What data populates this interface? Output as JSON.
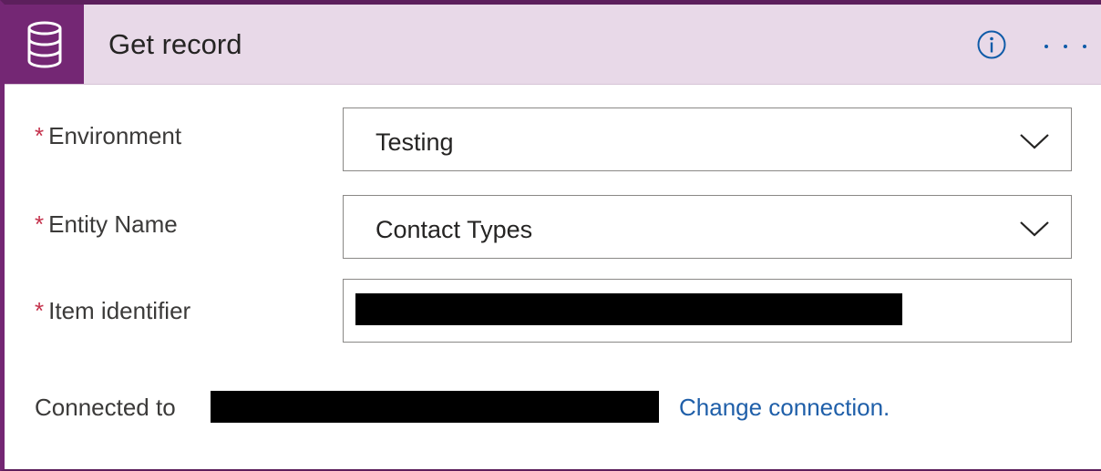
{
  "card": {
    "title": "Get record",
    "icon": "database-icon",
    "info_icon": "info-icon",
    "more_icon": "more-options-icon"
  },
  "fields": [
    {
      "label": "Environment",
      "required_marker": "*",
      "value": "Testing",
      "type": "dropdown"
    },
    {
      "label": "Entity Name",
      "required_marker": "*",
      "value": "Contact Types",
      "type": "dropdown"
    },
    {
      "label": "Item identifier",
      "required_marker": "*",
      "value": "",
      "type": "text",
      "redacted": true
    }
  ],
  "footer": {
    "connected_label": "Connected to",
    "connection_redacted": true,
    "change_link": "Change connection."
  },
  "colors": {
    "accent": "#742774",
    "header_bg": "#e8d9e8",
    "link": "#1f5fa9",
    "required": "#c4314b",
    "icon_blue": "#0f5ba8"
  }
}
